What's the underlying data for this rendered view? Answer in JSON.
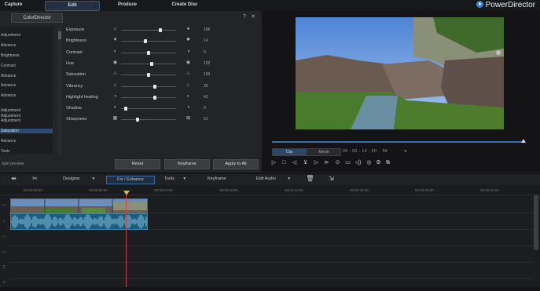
{
  "nav": {
    "tabs": [
      {
        "label": "Capture",
        "active": false
      },
      {
        "label": "Edit",
        "active": true
      },
      {
        "label": "Produce",
        "active": false
      },
      {
        "label": "Create Disc",
        "active": false
      }
    ],
    "brand": "PowerDirector"
  },
  "color_director": {
    "title": "ColorDirector",
    "presets": [
      "",
      "Adjustment",
      "",
      "Advance",
      "",
      "Brightness",
      "",
      "Contrast",
      "",
      "Advance",
      "",
      "Advance",
      "",
      "Advance",
      "",
      "",
      "Adjustment",
      "Adjustment",
      "Adjustment",
      "",
      "Saturation",
      "",
      "Advance",
      "",
      "Tools"
    ],
    "adjustments": [
      {
        "label": "Exposure",
        "value": "106",
        "level": 0.72
      },
      {
        "label": "Brightness",
        "value": "14",
        "level": 0.44
      },
      {
        "label": "Contrast",
        "value": "0",
        "level": 0.5
      },
      {
        "label": "Hue",
        "value": "102",
        "level": 0.55
      },
      {
        "label": "Saturation",
        "value": "100",
        "level": 0.5
      },
      {
        "label": "Vibrancy",
        "value": "26",
        "level": 0.62
      },
      {
        "label": "Highlight healing",
        "value": "43",
        "level": 0.62
      },
      {
        "label": "Shadow",
        "value": "0",
        "level": 0.08
      },
      {
        "label": "Sharpness",
        "value": "51",
        "level": 0.3
      }
    ],
    "split_preview": "Split preview",
    "buttons": {
      "reset": "Reset",
      "keyframe": "Keyframe",
      "apply_all": "Apply to All"
    }
  },
  "preview": {
    "clip_mode": "Clip",
    "movie_mode": "Movie",
    "timecode": "00 : 00 : 14 : 00",
    "fit": "Fit",
    "progress": 0.99
  },
  "timeline_toolbar": {
    "designer": "Designer",
    "fix_enhance": "Fix / Enhance",
    "tools": "Tools",
    "keyframe": "Keyframe",
    "edit_audio": "Edit Audio"
  },
  "ruler": {
    "ticks": [
      "00;00;00;00",
      "00;00;06;00",
      "00;00;12;00",
      "00;00;18;00",
      "00;01;12;00",
      "00;00;30;00",
      "00;00;36;00",
      "00;00;42;00"
    ]
  },
  "icons": {
    "slider_left": [
      "sun-outline",
      "sun-small",
      "contrast-circle",
      "hue-circle",
      "saturation-drops",
      "vibrancy-drops",
      "highlight-half",
      "shadow-half",
      "sharpness-grid"
    ],
    "slider_right": [
      "sun-filled",
      "sun-burst",
      "contrast-full",
      "hue-full",
      "saturation-full",
      "vibrancy-full",
      "highlight-full",
      "shadow-full",
      "sharpness-dots"
    ]
  },
  "colors": {
    "accent": "#3c6aa0",
    "playhead": "#c9404a",
    "audio_clip": "#1f5b7a"
  }
}
